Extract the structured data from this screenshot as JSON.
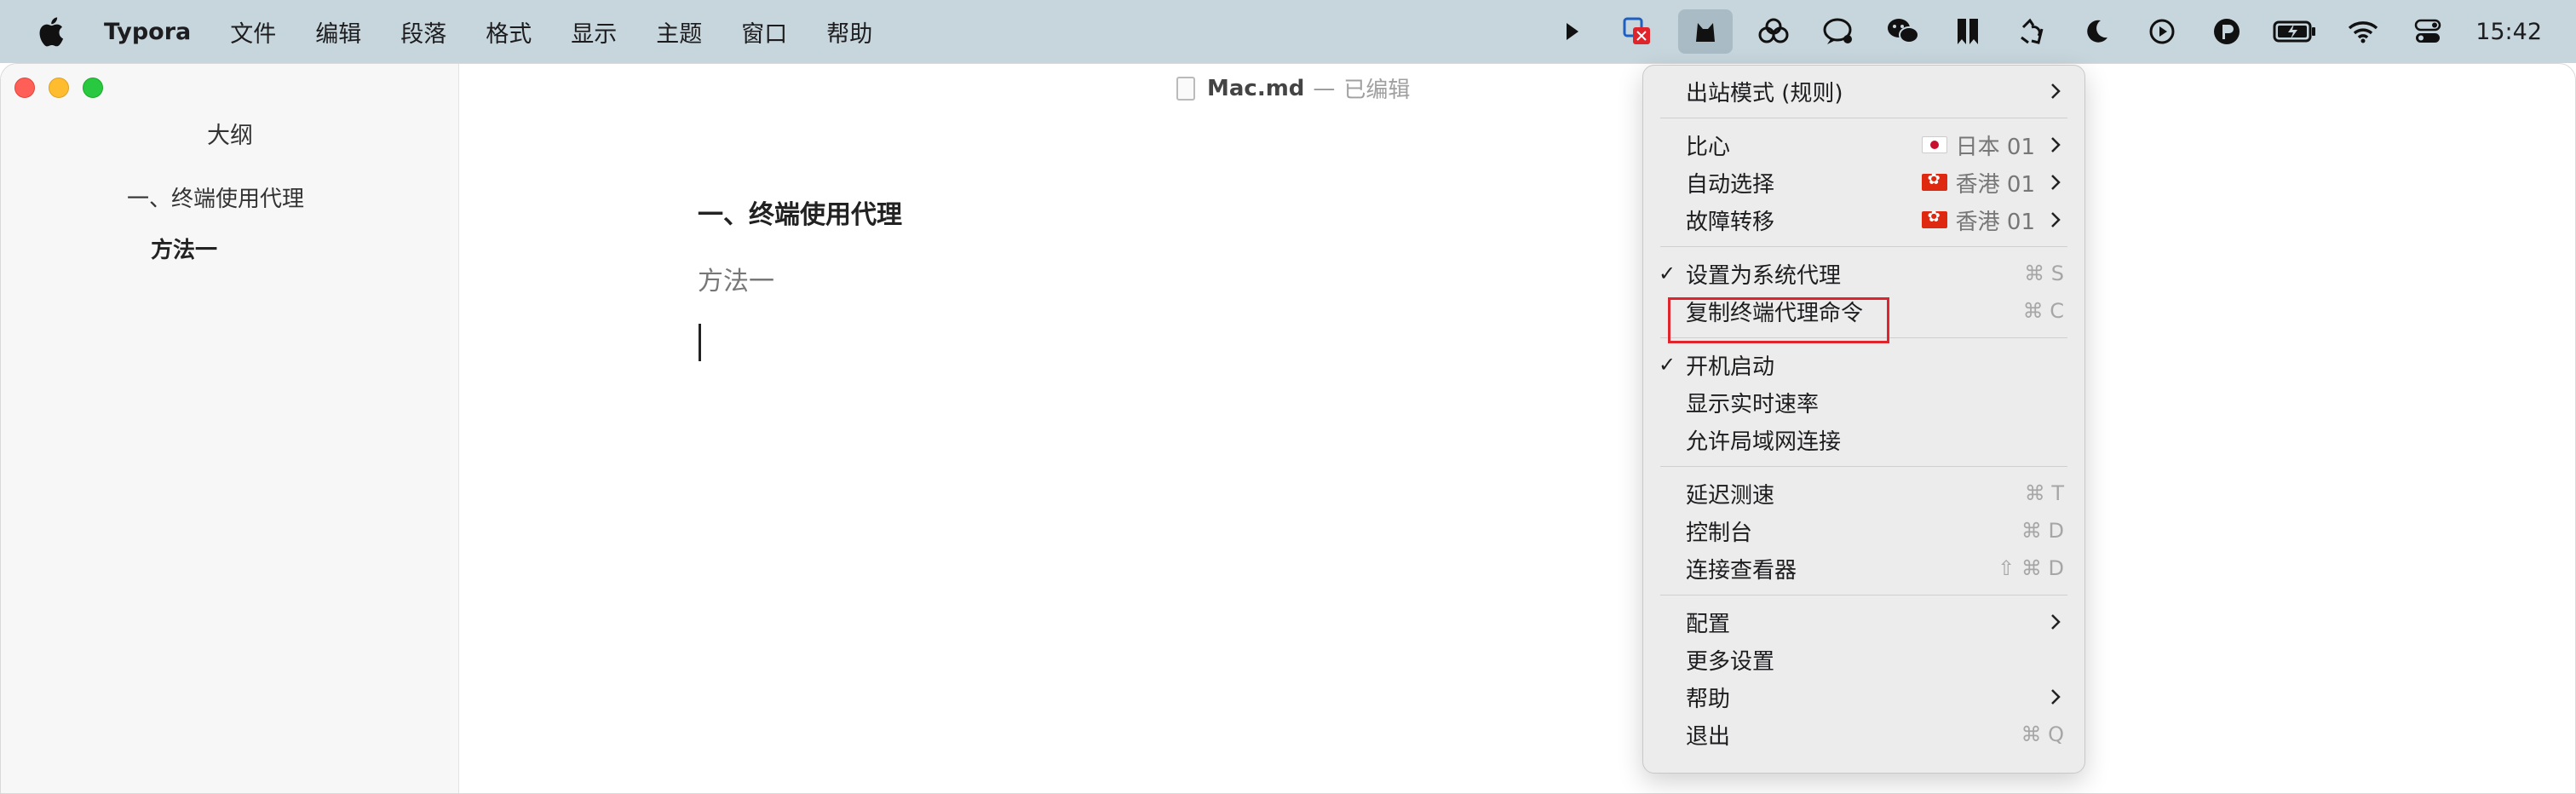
{
  "menubar": {
    "app_name": "Typora",
    "items": [
      "文件",
      "编辑",
      "段落",
      "格式",
      "显示",
      "主题",
      "窗口",
      "帮助"
    ],
    "status_icons": [
      "chevron-right-icon",
      "parallels-icon",
      "clash-cat-icon",
      "link-rings-icon",
      "chat-icon",
      "wechat-icon",
      "bookmark-icon",
      "recycle-icon",
      "moon-icon",
      "play-icon",
      "pocket-icon",
      "battery-icon",
      "wifi-icon",
      "control-center-icon"
    ],
    "clock": "15:42"
  },
  "window": {
    "title_file": "Mac.md",
    "title_separator": "—",
    "title_status": "已编辑"
  },
  "sidebar": {
    "title": "大纲",
    "items": [
      {
        "level": 1,
        "label": "一、终端使用代理"
      },
      {
        "level": 2,
        "label": "方法一"
      }
    ]
  },
  "editor": {
    "heading1": "一、终端使用代理",
    "heading2": "方法一"
  },
  "dropdown": {
    "outbound_mode": "出站模式 (规则)",
    "groups": [
      {
        "label": "比心",
        "server": "日本 01",
        "flag": "jp"
      },
      {
        "label": "自动选择",
        "server": "香港 01",
        "flag": "hk"
      },
      {
        "label": "故障转移",
        "server": "香港 01",
        "flag": "hk"
      }
    ],
    "system_proxy": {
      "label": "设置为系统代理",
      "checked": true,
      "shortcut": "⌘ S"
    },
    "copy_terminal": {
      "label": "复制终端代理命令",
      "shortcut": "⌘ C"
    },
    "launch_at_login": {
      "label": "开机启动",
      "checked": true
    },
    "show_speed": "显示实时速率",
    "allow_lan": "允许局域网连接",
    "latency_test": {
      "label": "延迟测速",
      "shortcut": "⌘ T"
    },
    "dashboard": {
      "label": "控制台",
      "shortcut": "⌘ D"
    },
    "conn_viewer": {
      "label": "连接查看器",
      "shortcut": "⇧ ⌘ D"
    },
    "config": "配置",
    "more_settings": "更多设置",
    "help": "帮助",
    "quit": {
      "label": "退出",
      "shortcut": "⌘ Q"
    },
    "check_mark": "✓",
    "highlight_color": "#e0242b"
  }
}
